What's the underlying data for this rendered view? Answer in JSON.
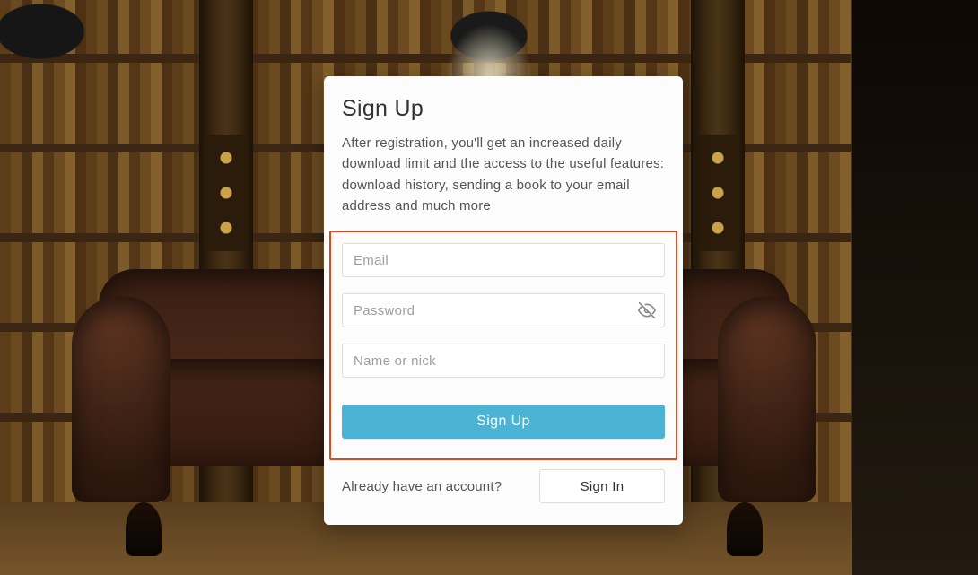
{
  "modal": {
    "title": "Sign Up",
    "description": "After registration, you'll get an increased daily download limit and the access to the useful features: download history, sending a book to your email address and much more",
    "email": {
      "placeholder": "Email",
      "value": ""
    },
    "password": {
      "placeholder": "Password",
      "value": ""
    },
    "name": {
      "placeholder": "Name or nick",
      "value": ""
    },
    "submit_label": "Sign Up",
    "already_text": "Already have an account?",
    "signin_label": "Sign In"
  },
  "icons": {
    "eye_hidden": "eye-off-icon"
  },
  "colors": {
    "accent": "#4cb3d4",
    "highlight_border": "#de4b1a"
  }
}
